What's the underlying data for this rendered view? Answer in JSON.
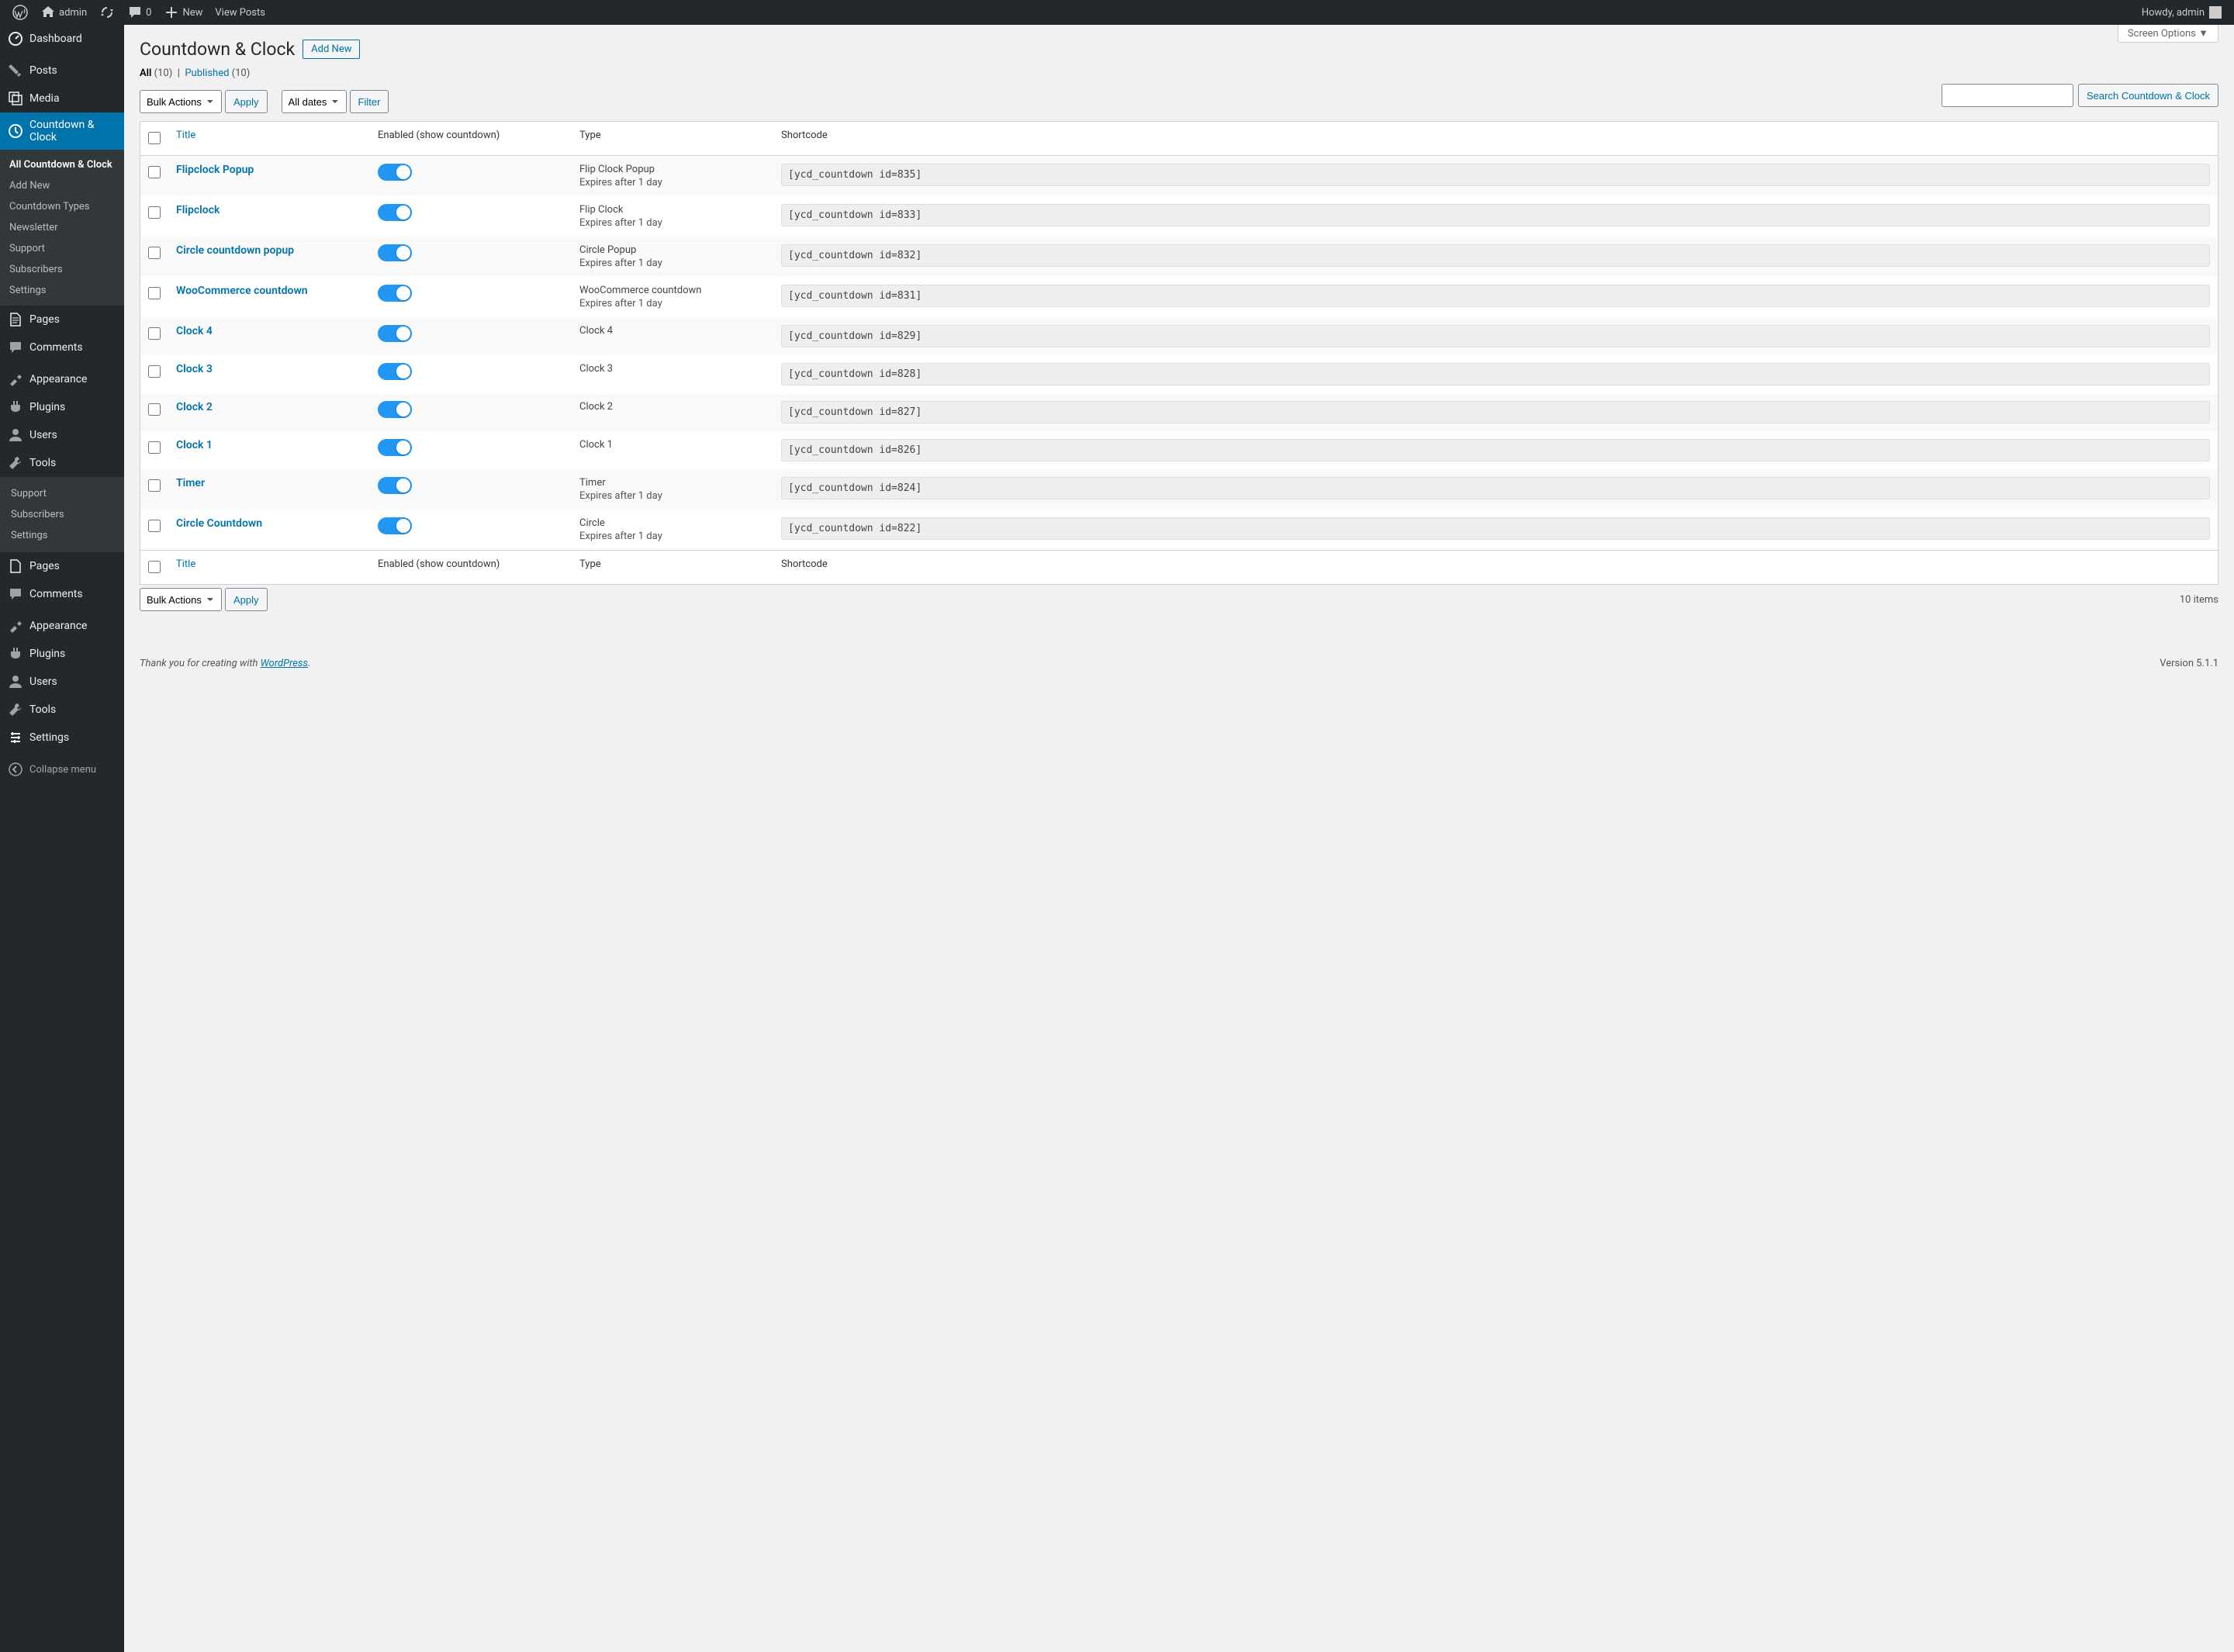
{
  "adminbar": {
    "site_name": "admin",
    "comments_count": "0",
    "new_label": "New",
    "view_posts_label": "View Posts",
    "howdy": "Howdy, admin"
  },
  "sidebar": {
    "dashboard": "Dashboard",
    "posts": "Posts",
    "media": "Media",
    "countdown_clock": "Countdown & Clock",
    "countdown_submenu": {
      "all": "All Countdown & Clock",
      "add_new": "Add New",
      "types": "Countdown Types",
      "newsletter": "Newsletter",
      "support": "Support",
      "subscribers": "Subscribers",
      "settings": "Settings"
    },
    "pages": "Pages",
    "comments": "Comments",
    "appearance": "Appearance",
    "plugins": "Plugins",
    "users": "Users",
    "tools": "Tools",
    "settings": "Settings",
    "flyout": {
      "support": "Support",
      "subscribers": "Subscribers",
      "settings": "Settings"
    },
    "collapse": "Collapse menu"
  },
  "screen_options": "Screen Options",
  "page_title": "Countdown & Clock",
  "add_new": "Add New",
  "filters": {
    "all_label": "All",
    "all_count": "(10)",
    "published_label": "Published",
    "published_count": "(10)",
    "bulk_actions": "Bulk Actions",
    "apply": "Apply",
    "all_dates": "All dates",
    "filter": "Filter",
    "items_count": "10 items",
    "search_button": "Search Countdown & Clock"
  },
  "columns": {
    "title": "Title",
    "enabled": "Enabled (show countdown)",
    "type": "Type",
    "shortcode": "Shortcode"
  },
  "rows": [
    {
      "title": "Flipclock Popup",
      "type_line1": "Flip Clock Popup",
      "type_line2": "Expires after 1 day",
      "shortcode": "[ycd_countdown id=835]"
    },
    {
      "title": "Flipclock",
      "type_line1": "Flip Clock",
      "type_line2": "Expires after 1 day",
      "shortcode": "[ycd_countdown id=833]"
    },
    {
      "title": "Circle countdown popup",
      "type_line1": "Circle Popup",
      "type_line2": "Expires after 1 day",
      "shortcode": "[ycd_countdown id=832]"
    },
    {
      "title": "WooCommerce countdown",
      "type_line1": "WooCommerce countdown",
      "type_line2": "Expires after 1 day",
      "shortcode": "[ycd_countdown id=831]"
    },
    {
      "title": "Clock 4",
      "type_line1": "Clock 4",
      "type_line2": "",
      "shortcode": "[ycd_countdown id=829]"
    },
    {
      "title": "Clock 3",
      "type_line1": "Clock 3",
      "type_line2": "",
      "shortcode": "[ycd_countdown id=828]"
    },
    {
      "title": "Clock 2",
      "type_line1": "Clock 2",
      "type_line2": "",
      "shortcode": "[ycd_countdown id=827]"
    },
    {
      "title": "Clock 1",
      "type_line1": "Clock 1",
      "type_line2": "",
      "shortcode": "[ycd_countdown id=826]"
    },
    {
      "title": "Timer",
      "type_line1": "Timer",
      "type_line2": "Expires after 1 day",
      "shortcode": "[ycd_countdown id=824]"
    },
    {
      "title": "Circle Countdown",
      "type_line1": "Circle",
      "type_line2": "Expires after 1 day",
      "shortcode": "[ycd_countdown id=822]"
    }
  ],
  "footer": {
    "thanks_prefix": "Thank you for creating with ",
    "wordpress": "WordPress",
    "version": "Version 5.1.1"
  }
}
